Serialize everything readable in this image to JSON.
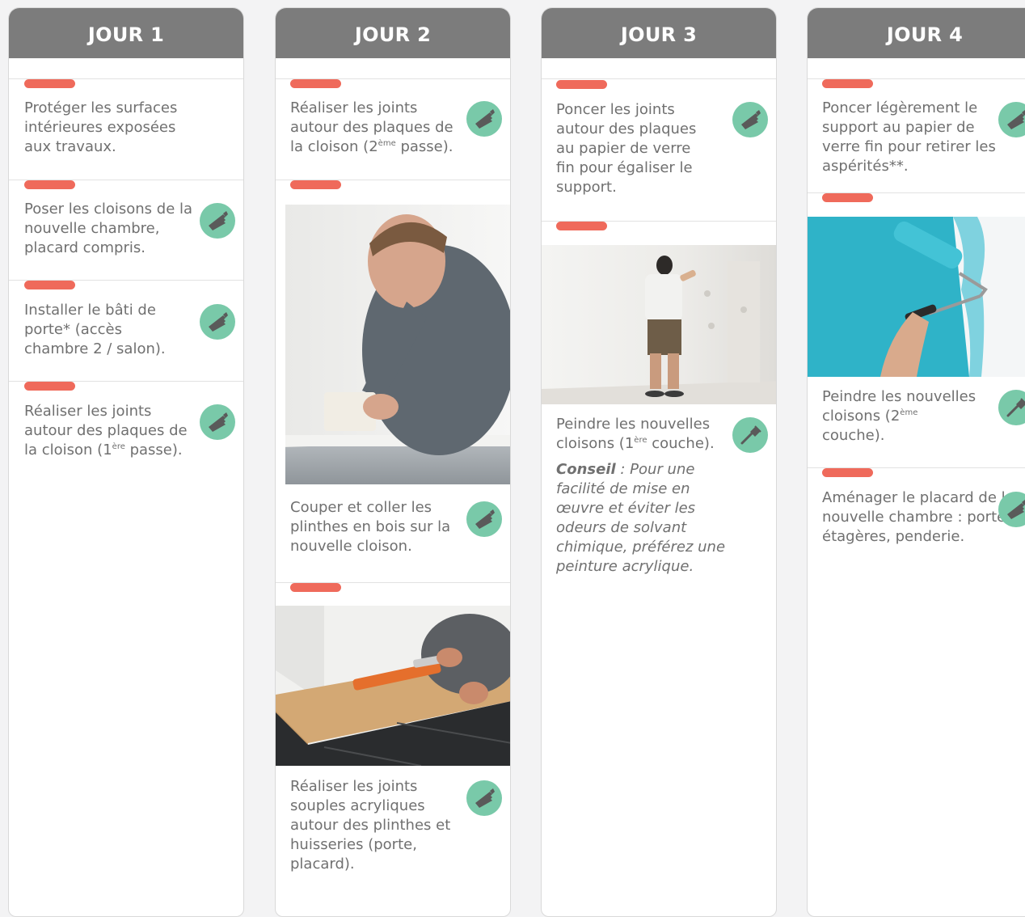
{
  "columns": [
    {
      "title": "JOUR 1",
      "tasks": [
        {
          "text": "Protéger les surfaces intérieures exposées aux travaux.",
          "icon": null
        },
        {
          "text": "Poser les cloisons de la nouvelle chambre, placard compris.",
          "icon": "saw-icon"
        },
        {
          "text": "Installer le bâti de porte* (accès chambre 2 / salon).",
          "icon": "saw-icon"
        },
        {
          "pre": "Réaliser les joints autour des plaques de la cloison (1",
          "sup": "ère",
          "post": " passe).",
          "icon": "saw-icon"
        }
      ]
    },
    {
      "title": "JOUR 2",
      "tasks": [
        {
          "pre": "Réaliser les joints autour des plaques de la cloison (2",
          "sup": "ème",
          "post": " passe).",
          "icon": "saw-icon"
        },
        {
          "text": "Couper et coller les plinthes en bois sur la nouvelle cloison.",
          "icon": "saw-icon"
        },
        {
          "text": "Réaliser les joints souples acryliques autour des plinthes et huisseries (porte, placard).",
          "icon": "saw-icon"
        }
      ]
    },
    {
      "title": "JOUR 3",
      "tasks": [
        {
          "text": "Poncer les joints autour des plaques au papier de verre fin pour égaliser le support.",
          "icon": "saw-icon"
        },
        {
          "pre": "Peindre les nouvelles cloisons (1",
          "sup": "ère",
          "post": " couche).",
          "icon": "paintbrush-icon"
        }
      ],
      "tip_label": "Conseil",
      "tip_text": " : Pour une facilité de mise en œuvre et éviter les odeurs de solvant chimique, préférez une peinture acrylique."
    },
    {
      "title": "JOUR 4",
      "tasks": [
        {
          "text": "Poncer légèrement le support au papier de verre fin pour retirer les aspérités**.",
          "icon": "saw-icon"
        },
        {
          "pre": "Peindre les nouvelles cloisons (2",
          "sup": "ème",
          "post": " couche).",
          "icon": "paintbrush-icon"
        },
        {
          "text": "Aménager le placard de la nouvelle chambre : portes, étagères, penderie.",
          "icon": "saw-icon"
        }
      ]
    }
  ],
  "colors": {
    "header": "#7c7c7c",
    "accent_bar": "#ef6a5b",
    "icon_circle": "#79c9a9",
    "text": "#707070"
  }
}
